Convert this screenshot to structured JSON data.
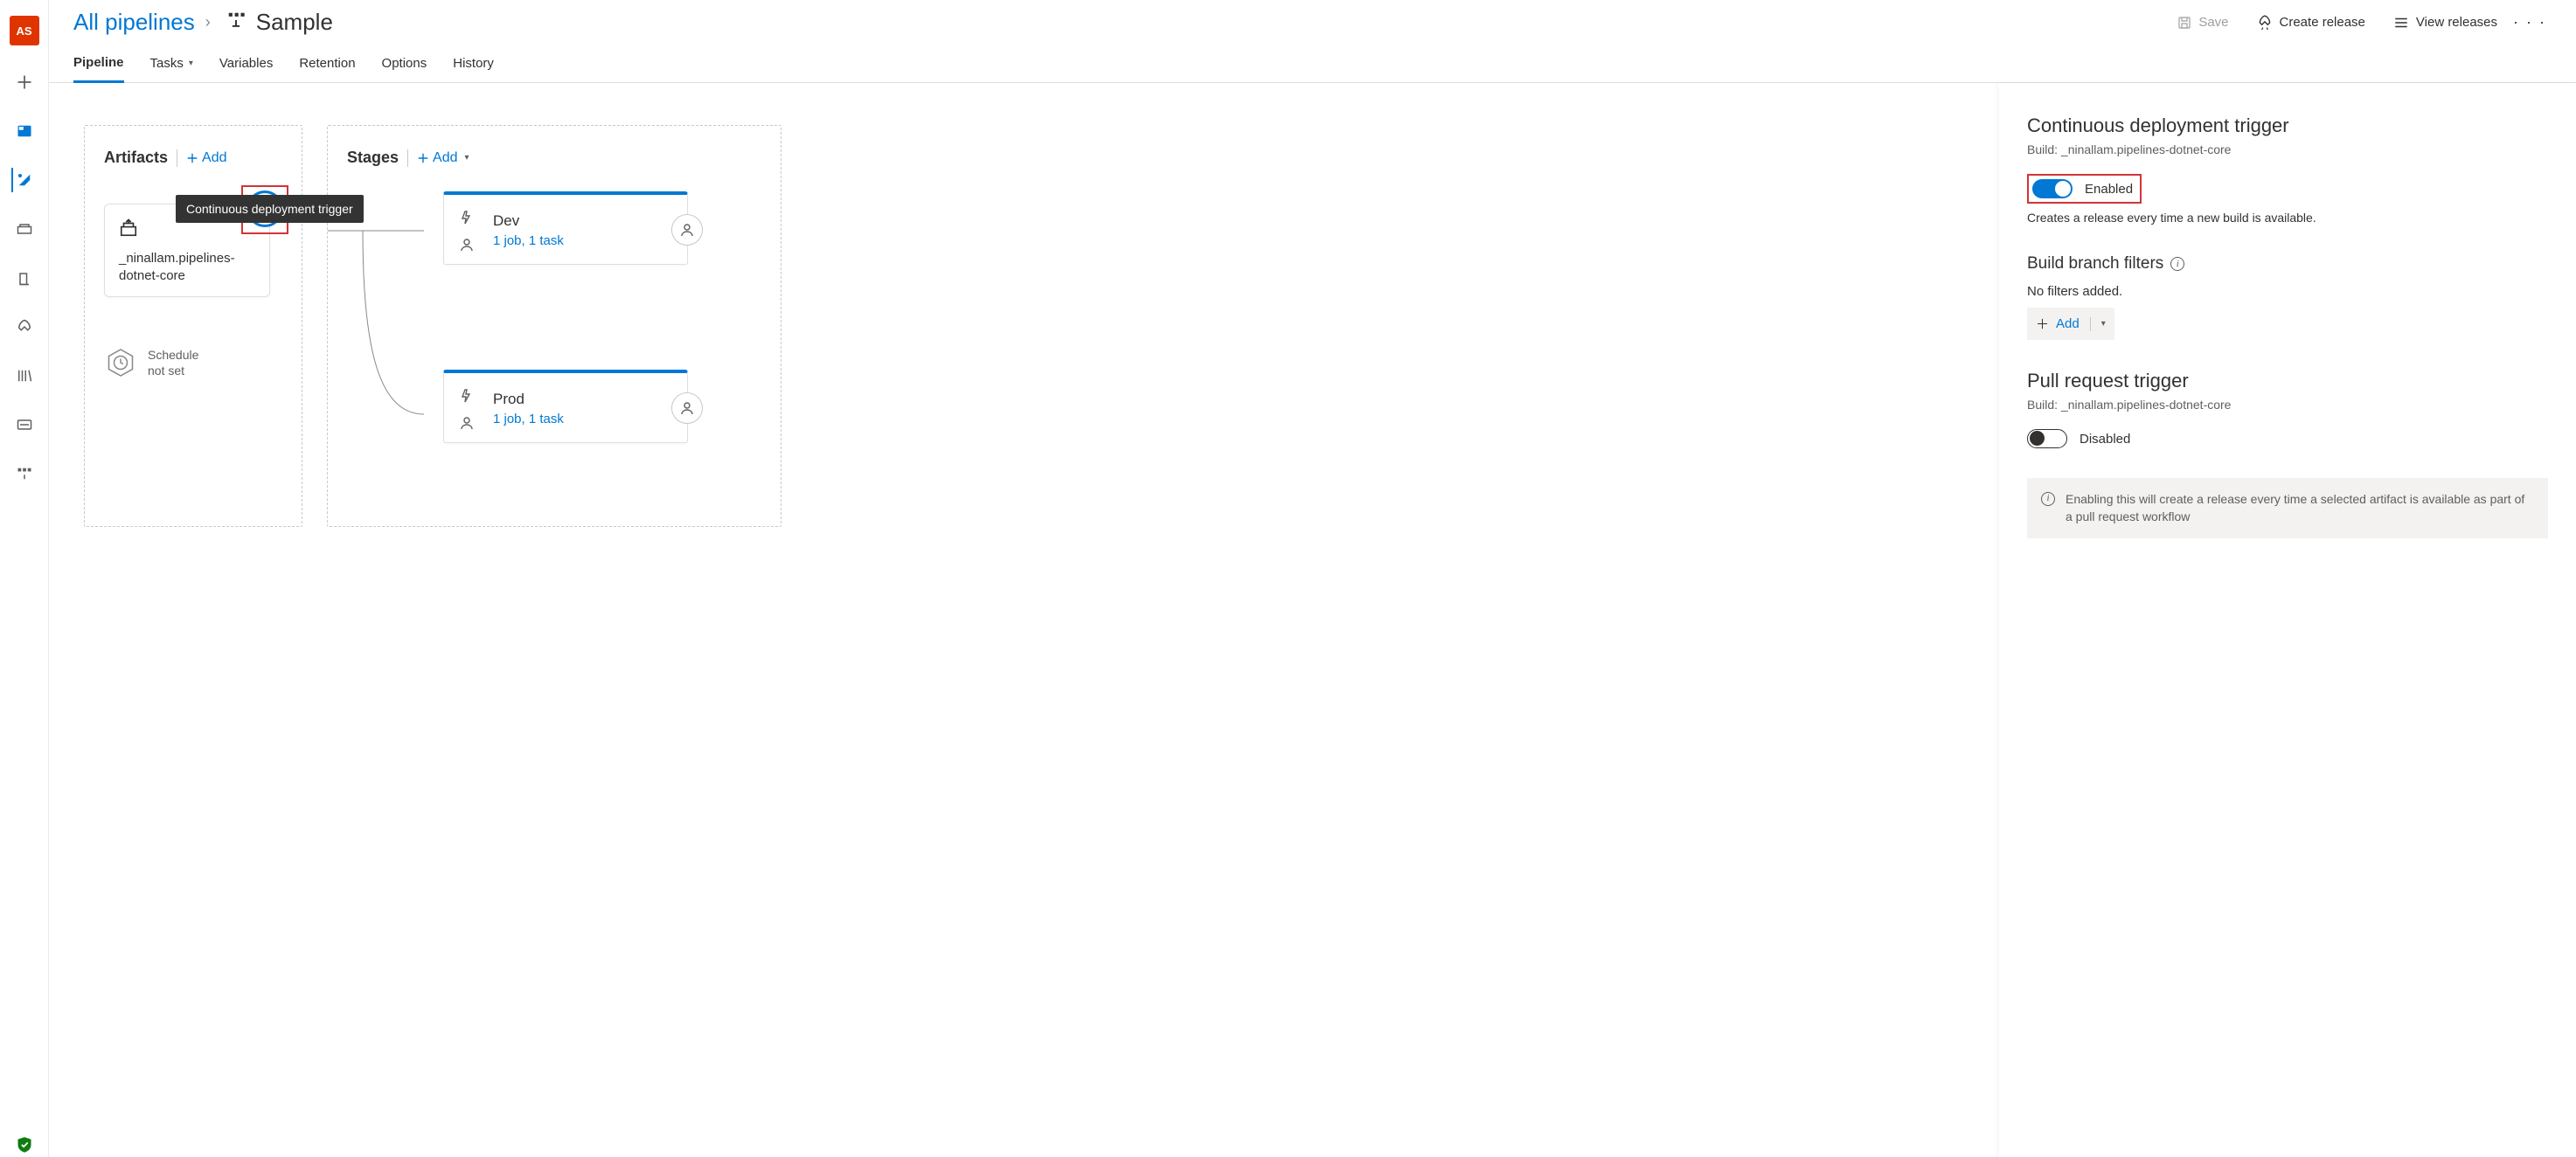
{
  "rail": {
    "avatar_initials": "AS"
  },
  "breadcrumb": {
    "root": "All pipelines",
    "title": "Sample"
  },
  "header_actions": {
    "save": "Save",
    "create_release": "Create release",
    "view_releases": "View releases"
  },
  "tabs": {
    "pipeline": "Pipeline",
    "tasks": "Tasks",
    "variables": "Variables",
    "retention": "Retention",
    "options": "Options",
    "history": "History"
  },
  "canvas": {
    "artifacts_label": "Artifacts",
    "artifacts_add": "Add",
    "stages_label": "Stages",
    "stages_add": "Add",
    "tooltip": "Continuous deployment trigger",
    "artifact_name": "_ninallam.pipelines-dotnet-core",
    "schedule_line1": "Schedule",
    "schedule_line2": "not set",
    "stages": [
      {
        "name": "Dev",
        "jobs": "1 job, 1 task"
      },
      {
        "name": "Prod",
        "jobs": "1 job, 1 task"
      }
    ]
  },
  "panel": {
    "cd_title": "Continuous deployment trigger",
    "cd_build": "Build: _ninallam.pipelines-dotnet-core",
    "cd_toggle_label": "Enabled",
    "cd_desc": "Creates a release every time a new build is available.",
    "filters_title": "Build branch filters",
    "filters_empty": "No filters added.",
    "filters_add": "Add",
    "pr_title": "Pull request trigger",
    "pr_build": "Build: _ninallam.pipelines-dotnet-core",
    "pr_toggle_label": "Disabled",
    "pr_callout": "Enabling this will create a release every time a selected artifact is available as part of a pull request workflow"
  }
}
